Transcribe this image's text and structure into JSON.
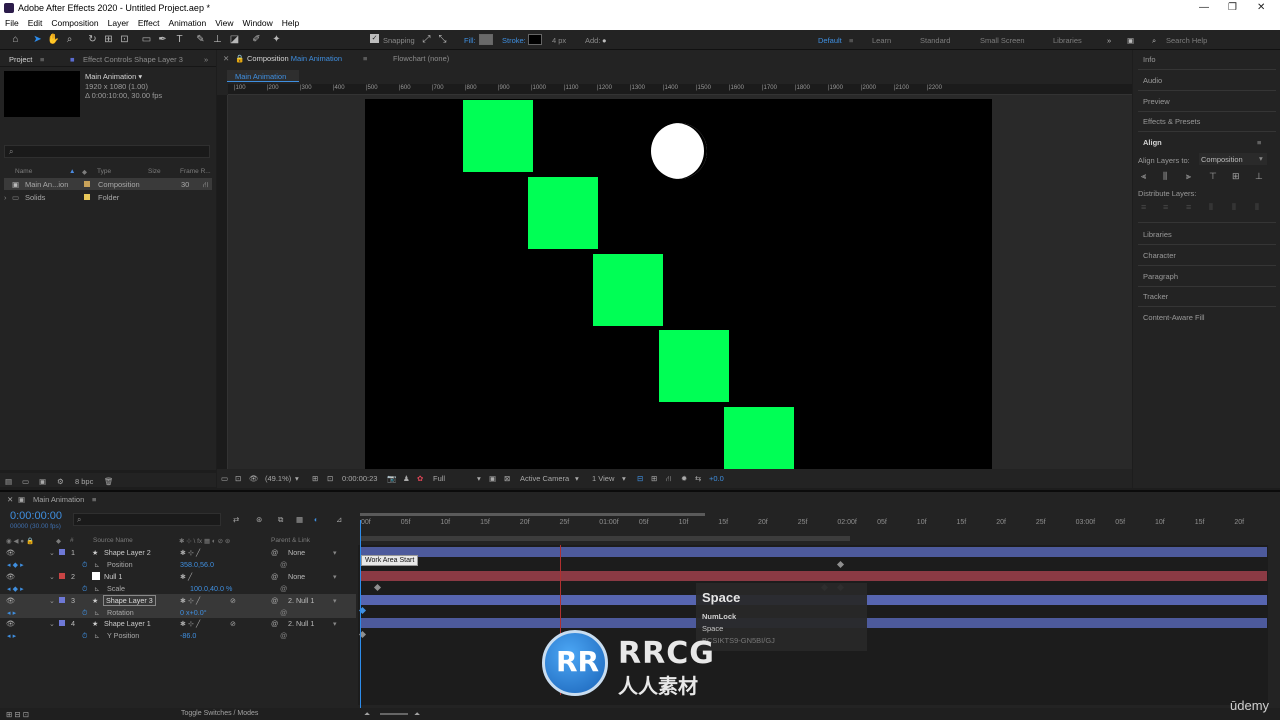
{
  "window": {
    "title": "Adobe After Effects 2020 - Untitled Project.aep *",
    "minimize": "—",
    "maximize": "❐",
    "close": "✕"
  },
  "menu": [
    "File",
    "Edit",
    "Composition",
    "Layer",
    "Effect",
    "Animation",
    "View",
    "Window",
    "Help"
  ],
  "toolbar": {
    "snapping": "Snapping",
    "fill": "Fill:",
    "stroke": "Stroke:",
    "stroke_width": "4 px",
    "add": "Add:",
    "fill_color": "#6a6a6a",
    "workspaces": [
      "Default",
      "Learn",
      "Standard",
      "Small Screen",
      "Libraries"
    ],
    "search_help": "Search Help"
  },
  "project": {
    "tab_project": "Project",
    "tab_effect_controls": "Effect Controls Shape Layer 3",
    "comp_name": "Main Animation ▾",
    "comp_size": "1920 x 1080 (1.00)",
    "comp_duration": "Δ 0:00:10:00, 30.00 fps",
    "columns": [
      "Name",
      "Type",
      "Size",
      "Frame R..."
    ],
    "items": [
      {
        "name": "Main An...ion",
        "type": "Composition",
        "size": "",
        "rate": "30",
        "label_color": "#c9a35a"
      },
      {
        "name": "Solids",
        "type": "Folder",
        "size": "",
        "rate": "",
        "label_color": "#e8c75a"
      }
    ],
    "bpc": "8 bpc"
  },
  "viewer": {
    "tab_comp_prefix": "Composition ",
    "tab_comp_name": "Main Animation",
    "tab_flowchart": "Flowchart (none)",
    "sub_tab": "Main Animation",
    "ruler_labels": [
      "|100",
      "|200",
      "|300",
      "|400",
      "|500",
      "|600",
      "|700",
      "|800",
      "|900",
      "|1000",
      "|1100",
      "|1200",
      "|1300",
      "|1400",
      "|1500",
      "|1600",
      "|1700",
      "|1800",
      "|1900",
      "|2000",
      "|2100",
      "|2200"
    ],
    "zoom": "(49.1%)",
    "timecode": "0:00:00:23",
    "resolution": "Full",
    "camera": "Active Camera",
    "views": "1 View",
    "exposure": "+0.0",
    "square_color": "#00ff55"
  },
  "right_panel": {
    "items_top": [
      "Info",
      "Audio",
      "Preview",
      "Effects & Presets"
    ],
    "align": "Align",
    "align_layers_to": "Align Layers to:",
    "align_target": "Composition",
    "distribute": "Distribute Layers:",
    "items_bottom": [
      "Libraries",
      "Character",
      "Paragraph",
      "Tracker",
      "Content-Aware Fill"
    ]
  },
  "timeline": {
    "tab": "Main Animation",
    "timecode": "0:00:00:00",
    "timecode_sub": "00000 (30.00 fps)",
    "col_source": "Source Name",
    "col_parent": "Parent & Link",
    "ruler": [
      "00f",
      "05f",
      "10f",
      "15f",
      "20f",
      "25f",
      "01:00f",
      "05f",
      "10f",
      "15f",
      "20f",
      "25f",
      "02:00f",
      "05f",
      "10f",
      "15f",
      "20f",
      "25f",
      "03:00f",
      "05f",
      "10f",
      "15f",
      "20f"
    ],
    "layers": [
      {
        "num": "1",
        "name": "Shape Layer 2",
        "parent": "None",
        "label_color": "#6e78d6",
        "prop": "Position",
        "value": "358.0,56.0",
        "bar_color": "#4d5a9c"
      },
      {
        "num": "2",
        "name": "Null 1",
        "parent": "None",
        "label_color": "#c84444",
        "prop": "Scale",
        "value": "100.0,40.0 %",
        "bar_color": "#8b3a44"
      },
      {
        "num": "3",
        "name": "Shape Layer 3",
        "parent": "2. Null 1",
        "label_color": "#6e78d6",
        "prop": "Rotation",
        "value": "0 x+0.0°",
        "bar_color": "#5765b0"
      },
      {
        "num": "4",
        "name": "Shape Layer 1",
        "parent": "2. Null 1",
        "label_color": "#6e78d6",
        "prop": "Y Position",
        "value": "-86.0",
        "bar_color": "#4d5a9c"
      }
    ],
    "tooltip": "Work Area Start",
    "toggle": "Toggle Switches / Modes"
  },
  "key_overlay": {
    "key": "Space",
    "line1": "NumLock",
    "line2": "Space",
    "line3": "BCSIKTS9-GN5BI/GJ"
  },
  "watermark": {
    "mark": "RR",
    "brand": "RRCG",
    "sub": "人人素材"
  },
  "udemy": "ūdemy"
}
